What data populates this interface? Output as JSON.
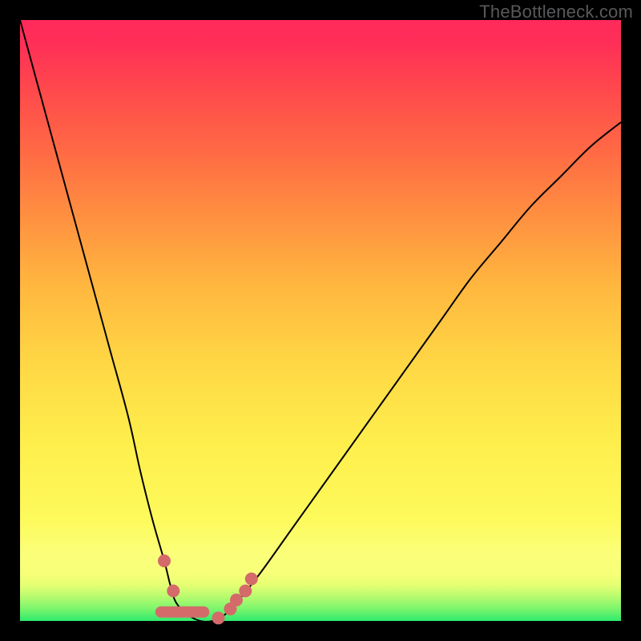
{
  "watermark": "TheBottleneck.com",
  "chart_data": {
    "type": "line",
    "title": "",
    "xlabel": "",
    "ylabel": "",
    "xlim": [
      0,
      100
    ],
    "ylim": [
      0,
      100
    ],
    "series": [
      {
        "name": "bottleneck-curve",
        "x": [
          0,
          3,
          6,
          9,
          12,
          15,
          18,
          20,
          22,
          24,
          25,
          26,
          28,
          30,
          32,
          34,
          36,
          40,
          45,
          50,
          55,
          60,
          65,
          70,
          75,
          80,
          85,
          90,
          95,
          100
        ],
        "y": [
          100,
          89,
          78,
          67,
          56,
          45,
          34,
          25,
          17,
          10,
          6,
          3,
          1,
          0,
          0,
          1,
          3,
          8,
          15,
          22,
          29,
          36,
          43,
          50,
          57,
          63,
          69,
          74,
          79,
          83
        ]
      }
    ],
    "markers": {
      "name": "highlight-points",
      "points": [
        {
          "x": 24,
          "y": 10
        },
        {
          "x": 25.5,
          "y": 5
        },
        {
          "x": 27,
          "y": 1.5,
          "type": "pill",
          "w": 9
        },
        {
          "x": 33,
          "y": 0.5
        },
        {
          "x": 35,
          "y": 2
        },
        {
          "x": 36,
          "y": 3.5
        },
        {
          "x": 37.5,
          "y": 5
        },
        {
          "x": 38.5,
          "y": 7
        }
      ]
    },
    "gradient_stops": [
      {
        "pos": 0,
        "color": "#2eea6e"
      },
      {
        "pos": 11,
        "color": "#fbff7a"
      },
      {
        "pos": 55,
        "color": "#ffb93f"
      },
      {
        "pos": 100,
        "color": "#ff2a5c"
      }
    ]
  }
}
